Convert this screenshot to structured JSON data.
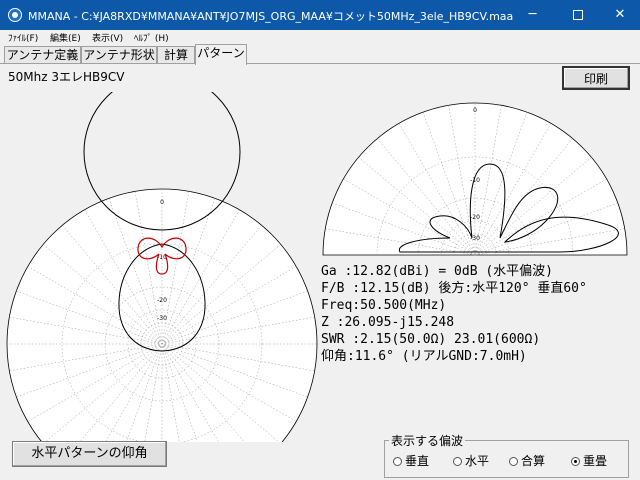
{
  "window": {
    "title": "MMANA - C:¥JA8RXD¥MMANA¥ANT¥JO7MJS_ORG_MAA¥コメット50MHz_3ele_HB9CV.maa",
    "min_icon": "minimize-icon",
    "max_icon": "maximize-icon",
    "close_icon": "close-icon"
  },
  "menu": [
    "ﾌｧｲﾙ(F)",
    "編集(E)",
    "表示(V)",
    "ﾍﾙﾌﾟ (H)"
  ],
  "tabs": [
    {
      "label": "アンテナ定義",
      "active": false
    },
    {
      "label": "アンテナ形状",
      "active": false
    },
    {
      "label": "計算",
      "active": false
    },
    {
      "label": "パターン",
      "active": true
    }
  ],
  "design_name": "50Mhz 3エレHB9CV",
  "print_label": "印刷",
  "horizontal_plot": {
    "ring_labels": [
      "0",
      "-10",
      "-20",
      "-30"
    ],
    "main_pattern_color": "#000000",
    "secondary_pattern_color": "#cc0000"
  },
  "vertical_plot": {
    "ring_labels": [
      "0",
      "-10",
      "-20",
      "-30"
    ],
    "pattern_color": "#000000"
  },
  "results": [
    "Ga  :12.82(dBi) = 0dB (水平偏波)",
    "F/B :12.15(dB) 後方:水平120° 垂直60°",
    "Freq:50.500(MHz)",
    "Z   :26.095-j15.248",
    "SWR :2.15(50.0Ω) 23.01(600Ω)",
    "仰角:11.6° (リアルGND:7.0mH)"
  ],
  "elev_button_label": "水平パターンの仰角",
  "polarization": {
    "legend": "表示する偏波",
    "options": [
      {
        "label": "垂直",
        "selected": false
      },
      {
        "label": "水平",
        "selected": false
      },
      {
        "label": "合算",
        "selected": false
      },
      {
        "label": "重畳",
        "selected": true
      }
    ]
  }
}
